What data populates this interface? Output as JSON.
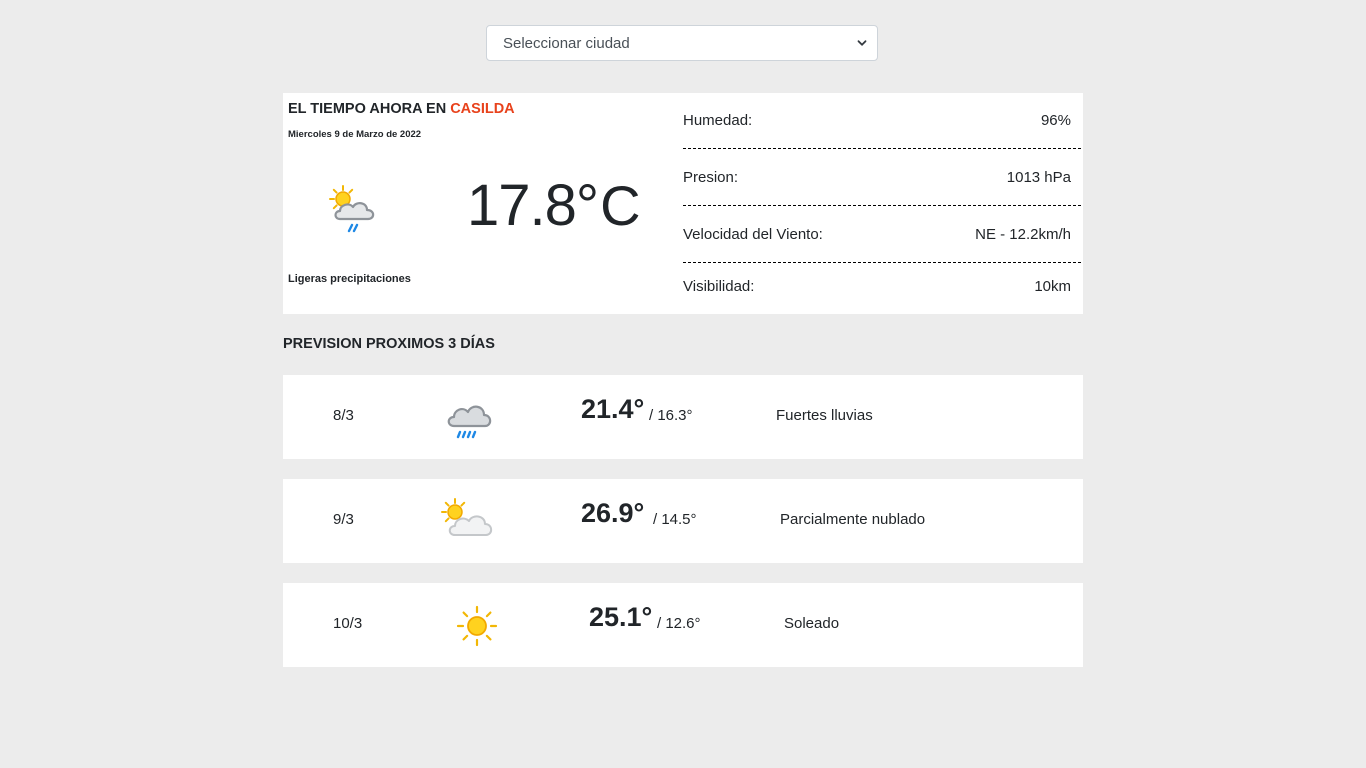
{
  "city_select": {
    "selected": "Seleccionar ciudad"
  },
  "current": {
    "title_prefix": "EL TIEMPO AHORA EN",
    "city": "CASILDA",
    "date": "Miercoles 9 de Marzo de 2022",
    "temperature": "17.8°",
    "unit": "C",
    "description": "Ligeras precipitaciones",
    "icon": "light-rain-icon",
    "city_color": "#e8421c"
  },
  "stats": [
    {
      "label": "Humedad:",
      "value": "96%"
    },
    {
      "label": "Presion:",
      "value": "1013 hPa"
    },
    {
      "label": "Velocidad del Viento:",
      "value": "NE - 12.2km/h"
    },
    {
      "label": "Visibilidad:",
      "value": "10km"
    }
  ],
  "forecast": {
    "title": "PREVISION PROXIMOS 3 DÍAS",
    "days": [
      {
        "date": "8/3",
        "icon": "heavy-rain-icon",
        "max": "21.4°",
        "min": "/ 16.3°",
        "description": "Fuertes lluvias"
      },
      {
        "date": "9/3",
        "icon": "partly-cloudy-icon",
        "max": "26.9°",
        "min": "/ 14.5°",
        "description": "Parcialmente nublado"
      },
      {
        "date": "10/3",
        "icon": "sunny-icon",
        "max": "25.1°",
        "min": "/ 12.6°",
        "description": "Soleado"
      }
    ]
  }
}
